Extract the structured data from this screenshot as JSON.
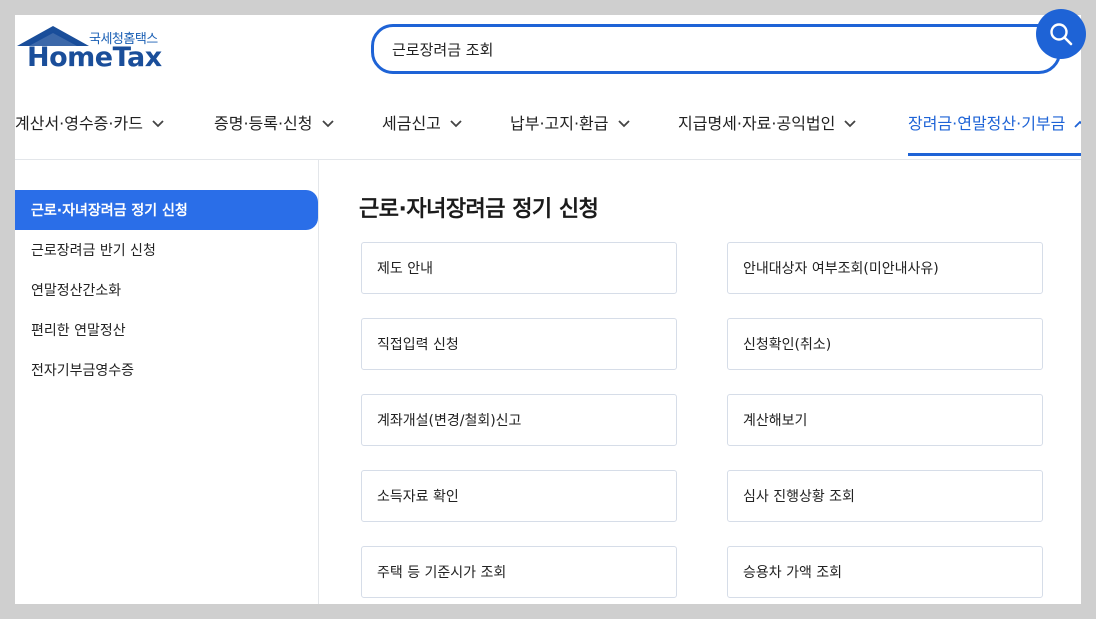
{
  "logo": {
    "sub_text": "국세청홈택스",
    "main_text": "HomeTax"
  },
  "search": {
    "value": "근로장려금 조회"
  },
  "icons": {
    "search": "search-icon",
    "chevron_down": "chevron-down-icon",
    "chevron_up": "chevron-up-icon",
    "house": "house-roof-icon"
  },
  "colors": {
    "accent": "#1e63d6",
    "active_sidebar": "#2a6ee8",
    "logo": "#1a4e9a"
  },
  "nav": {
    "items": [
      {
        "label": "계산서·영수증·카드"
      },
      {
        "label": "증명·등록·신청"
      },
      {
        "label": "세금신고"
      },
      {
        "label": "납부·고지·환급"
      },
      {
        "label": "지급명세·자료·공익법인"
      },
      {
        "label": "장려금·연말정산·기부금"
      }
    ],
    "active_index": 5
  },
  "sidebar": {
    "items": [
      {
        "label": "근로·자녀장려금 정기 신청"
      },
      {
        "label": "근로장려금 반기 신청"
      },
      {
        "label": "연말정산간소화"
      },
      {
        "label": "편리한 연말정산"
      },
      {
        "label": "전자기부금영수증"
      }
    ],
    "active_index": 0
  },
  "main": {
    "title": "근로·자녀장려금 정기 신청",
    "cards": [
      {
        "label": "제도 안내"
      },
      {
        "label": "안내대상자 여부조회(미안내사유)"
      },
      {
        "label": "직접입력 신청"
      },
      {
        "label": "신청확인(취소)"
      },
      {
        "label": "계좌개설(변경/철회)신고"
      },
      {
        "label": "계산해보기"
      },
      {
        "label": "소득자료 확인"
      },
      {
        "label": "심사 진행상황 조회"
      },
      {
        "label": "주택 등 기준시가 조회"
      },
      {
        "label": "승용차 가액 조회"
      }
    ]
  }
}
